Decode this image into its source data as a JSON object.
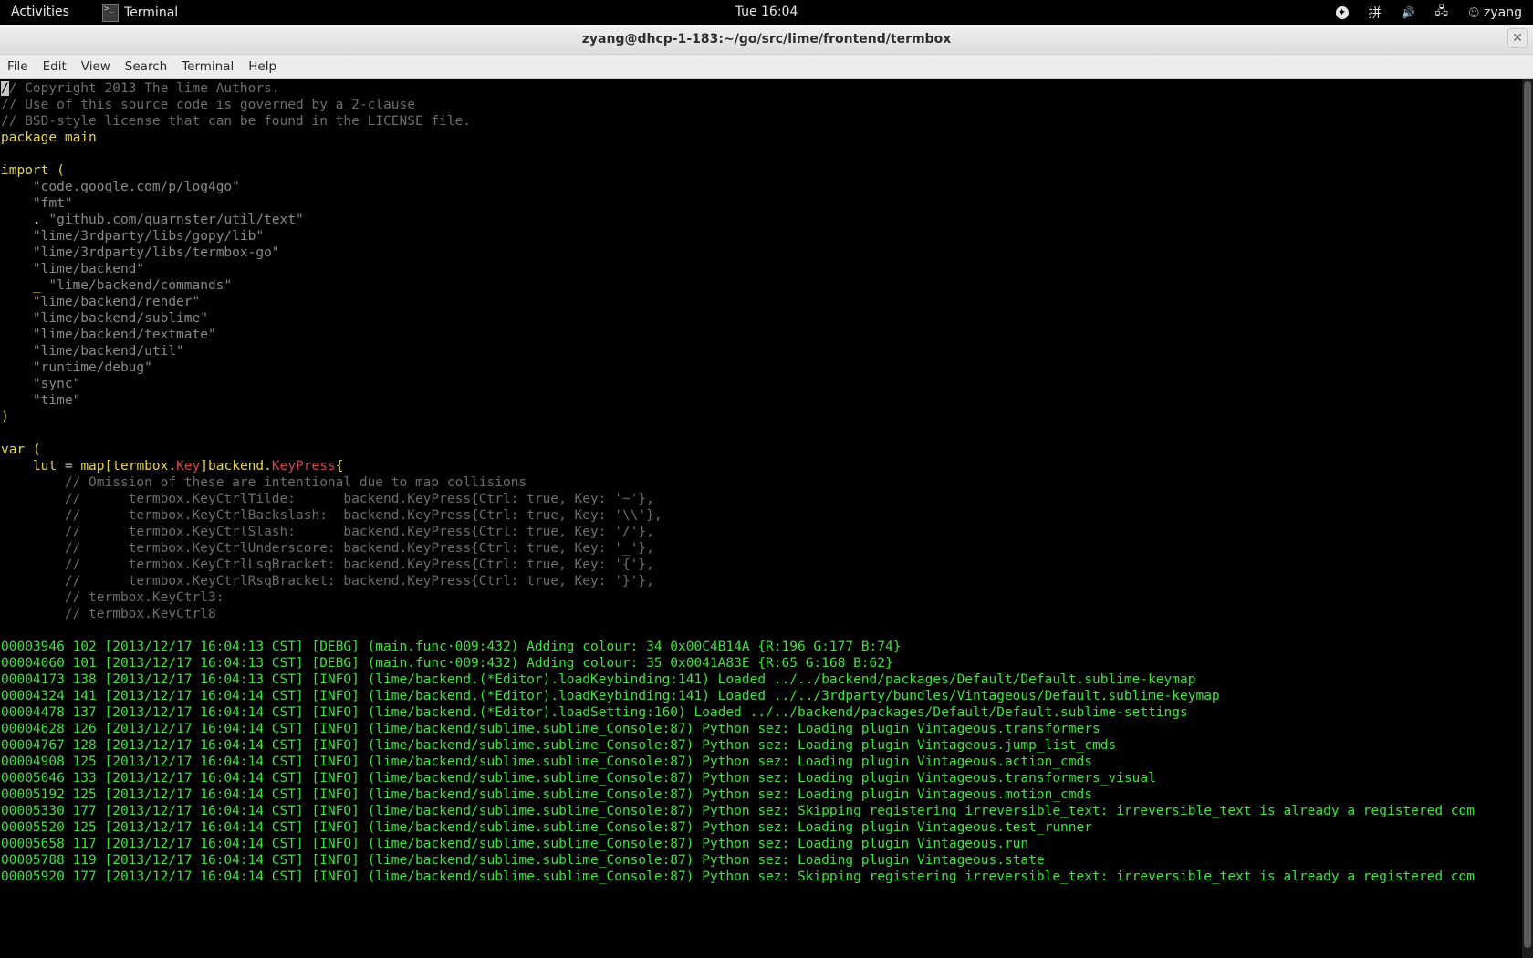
{
  "topbar": {
    "activities": "Activities",
    "app_name": "Terminal",
    "app_icon_glyph": ">_",
    "clock": "Tue 16:04",
    "status": {
      "accessibility_glyph": "✦",
      "input_method": "拼",
      "volume_glyph": "🔊",
      "network_glyph": "🖧",
      "user_glyph": "☺",
      "user": "zyang"
    }
  },
  "window": {
    "title": "zyang@dhcp-1-183:~/go/src/lime/frontend/termbox",
    "close_glyph": "✕"
  },
  "menu": {
    "items": [
      "File",
      "Edit",
      "View",
      "Search",
      "Terminal",
      "Help"
    ]
  },
  "source_lines": [
    [
      [
        "c",
        "/"
      ],
      [
        "c",
        "/ Copyright 2013 The lime Authors."
      ]
    ],
    [
      [
        "c",
        "// Use of this source code is governed by a 2-clause"
      ]
    ],
    [
      [
        "c",
        "// BSD-style license that can be found in the LICENSE file."
      ]
    ],
    [
      [
        "kw",
        "package"
      ],
      [
        "plain",
        " "
      ],
      [
        "kw",
        "main"
      ]
    ],
    [],
    [
      [
        "kw",
        "import"
      ],
      [
        "plain",
        " "
      ],
      [
        "kw",
        "("
      ]
    ],
    [
      [
        "str",
        "    \"code.google.com/p/log4go\""
      ]
    ],
    [
      [
        "str",
        "    \"fmt\""
      ]
    ],
    [
      [
        "kw",
        "    ."
      ],
      [
        "str",
        " \"github.com/quarnster/util/text\""
      ]
    ],
    [
      [
        "str",
        "    \"lime/3rdparty/libs/gopy/lib\""
      ]
    ],
    [
      [
        "str",
        "    \"lime/3rdparty/libs/termbox-go\""
      ]
    ],
    [
      [
        "str",
        "    \"lime/backend\""
      ]
    ],
    [
      [
        "kw",
        "    _"
      ],
      [
        "str",
        " \"lime/backend/commands\""
      ]
    ],
    [
      [
        "str",
        "    \"lime/backend/render\""
      ]
    ],
    [
      [
        "str",
        "    \"lime/backend/sublime\""
      ]
    ],
    [
      [
        "str",
        "    \"lime/backend/textmate\""
      ]
    ],
    [
      [
        "str",
        "    \"lime/backend/util\""
      ]
    ],
    [
      [
        "str",
        "    \"runtime/debug\""
      ]
    ],
    [
      [
        "str",
        "    \"sync\""
      ]
    ],
    [
      [
        "str",
        "    \"time\""
      ]
    ],
    [
      [
        "kw",
        ")"
      ]
    ],
    [],
    [
      [
        "kw",
        "var"
      ],
      [
        "plain",
        " "
      ],
      [
        "kw",
        "("
      ]
    ],
    [
      [
        "kw",
        "    lut"
      ],
      [
        "plain",
        " = "
      ],
      [
        "kw",
        "map"
      ],
      [
        "kw",
        "["
      ],
      [
        "kw",
        "termbox."
      ],
      [
        "ty",
        "Key"
      ],
      [
        "kw",
        "]"
      ],
      [
        "kw",
        "backend."
      ],
      [
        "ty",
        "KeyPress"
      ],
      [
        "kw",
        "{"
      ]
    ],
    [
      [
        "c",
        "        // Omission of these are intentional due to map collisions"
      ]
    ],
    [
      [
        "c",
        "        //      termbox.KeyCtrlTilde:      backend.KeyPress{Ctrl: true, Key: '~'},"
      ]
    ],
    [
      [
        "c",
        "        //      termbox.KeyCtrlBackslash:  backend.KeyPress{Ctrl: true, Key: '\\\\'},"
      ]
    ],
    [
      [
        "c",
        "        //      termbox.KeyCtrlSlash:      backend.KeyPress{Ctrl: true, Key: '/'},"
      ]
    ],
    [
      [
        "c",
        "        //      termbox.KeyCtrlUnderscore: backend.KeyPress{Ctrl: true, Key: '_'},"
      ]
    ],
    [
      [
        "c",
        "        //      termbox.KeyCtrlLsqBracket: backend.KeyPress{Ctrl: true, Key: '{'},"
      ]
    ],
    [
      [
        "c",
        "        //      termbox.KeyCtrlRsqBracket: backend.KeyPress{Ctrl: true, Key: '}'},"
      ]
    ],
    [
      [
        "c",
        "        // termbox.KeyCtrl3:"
      ]
    ],
    [
      [
        "c",
        "        // termbox.KeyCtrl8"
      ]
    ],
    []
  ],
  "log_lines": [
    "00003946 102 [2013/12/17 16:04:13 CST] [DEBG] (main.func·009:432) Adding colour: 34 0x00C4B14A {R:196 G:177 B:74}",
    "00004060 101 [2013/12/17 16:04:13 CST] [DEBG] (main.func·009:432) Adding colour: 35 0x0041A83E {R:65 G:168 B:62}",
    "00004173 138 [2013/12/17 16:04:13 CST] [INFO] (lime/backend.(*Editor).loadKeybinding:141) Loaded ../../backend/packages/Default/Default.sublime-keymap",
    "00004324 141 [2013/12/17 16:04:14 CST] [INFO] (lime/backend.(*Editor).loadKeybinding:141) Loaded ../../3rdparty/bundles/Vintageous/Default.sublime-keymap",
    "00004478 137 [2013/12/17 16:04:14 CST] [INFO] (lime/backend.(*Editor).loadSetting:160) Loaded ../../backend/packages/Default/Default.sublime-settings",
    "00004628 126 [2013/12/17 16:04:14 CST] [INFO] (lime/backend/sublime.sublime_Console:87) Python sez: Loading plugin Vintageous.transformers",
    "00004767 128 [2013/12/17 16:04:14 CST] [INFO] (lime/backend/sublime.sublime_Console:87) Python sez: Loading plugin Vintageous.jump_list_cmds",
    "00004908 125 [2013/12/17 16:04:14 CST] [INFO] (lime/backend/sublime.sublime_Console:87) Python sez: Loading plugin Vintageous.action_cmds",
    "00005046 133 [2013/12/17 16:04:14 CST] [INFO] (lime/backend/sublime.sublime_Console:87) Python sez: Loading plugin Vintageous.transformers_visual",
    "00005192 125 [2013/12/17 16:04:14 CST] [INFO] (lime/backend/sublime.sublime_Console:87) Python sez: Loading plugin Vintageous.motion_cmds",
    "00005330 177 [2013/12/17 16:04:14 CST] [INFO] (lime/backend/sublime.sublime_Console:87) Python sez: Skipping registering irreversible_text: irreversible_text is already a registered com",
    "00005520 125 [2013/12/17 16:04:14 CST] [INFO] (lime/backend/sublime.sublime_Console:87) Python sez: Loading plugin Vintageous.test_runner",
    "00005658 117 [2013/12/17 16:04:14 CST] [INFO] (lime/backend/sublime.sublime_Console:87) Python sez: Loading plugin Vintageous.run",
    "00005788 119 [2013/12/17 16:04:14 CST] [INFO] (lime/backend/sublime.sublime_Console:87) Python sez: Loading plugin Vintageous.state",
    "00005920 177 [2013/12/17 16:04:14 CST] [INFO] (lime/backend/sublime.sublime_Console:87) Python sez: Skipping registering irreversible_text: irreversible_text is already a registered com"
  ],
  "colors": {
    "comment": "#6d6d6d",
    "keyword": "#e6d44c",
    "string": "#8a8a8a",
    "type": "#d4464a",
    "log": "#3ce43c"
  }
}
